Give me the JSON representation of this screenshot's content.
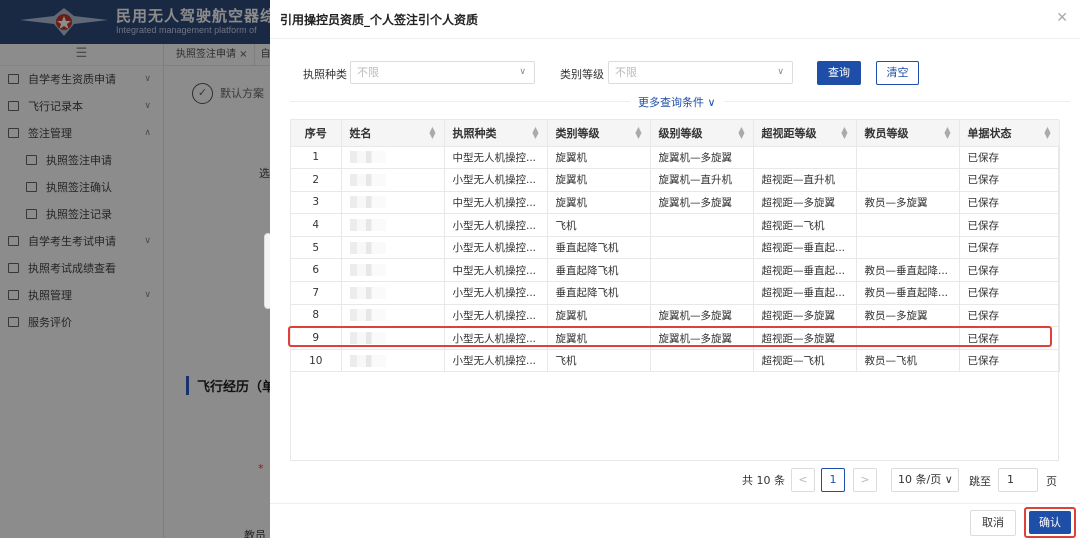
{
  "app": {
    "title": "民用无人驾驶航空器综合",
    "subtitle": "Integrated management platform of",
    "sidebar_toggle": "☰",
    "menu": [
      {
        "label": "自学考生资质申请",
        "chev": "∨",
        "sub": false
      },
      {
        "label": "飞行记录本",
        "chev": "∨",
        "sub": false
      },
      {
        "label": "签注管理",
        "chev": "∧",
        "sub": false
      },
      {
        "label": "执照签注申请",
        "chev": "",
        "sub": true
      },
      {
        "label": "执照签注确认",
        "chev": "",
        "sub": true
      },
      {
        "label": "执照签注记录",
        "chev": "",
        "sub": true
      },
      {
        "label": "自学考生考试申请",
        "chev": "∨",
        "sub": false
      },
      {
        "label": "执照考试成绩查看",
        "chev": "",
        "sub": false
      },
      {
        "label": "执照管理",
        "chev": "∨",
        "sub": false
      },
      {
        "label": "服务评价",
        "chev": "",
        "sub": false
      }
    ],
    "tabs": [
      "执照签注申请 ×",
      "自"
    ],
    "default_scheme": "默认方案",
    "bg_label_select": "选",
    "section_title": "飞行经历（单",
    "bg_star": "*",
    "bg_label_instructor": "教员"
  },
  "dialog": {
    "title": "引用操控员资质_个人签注引个人资质",
    "close": "✕",
    "filters": {
      "license_type_label": "执照种类",
      "license_type_value": "不限",
      "category_label": "类别等级",
      "category_value": "不限"
    },
    "search_label": "查询",
    "clear_label": "清空",
    "more_conditions": "更多查询条件 ∨",
    "columns": [
      "序号",
      "姓名",
      "执照种类",
      "类别等级",
      "级别等级",
      "超视距等级",
      "教员等级",
      "单据状态"
    ],
    "rows": [
      [
        "1",
        "",
        "中型无人机操控...",
        "旋翼机",
        "旋翼机—多旋翼",
        "",
        "",
        "已保存"
      ],
      [
        "2",
        "",
        "小型无人机操控...",
        "旋翼机",
        "旋翼机—直升机",
        "超视距—直升机",
        "",
        "已保存"
      ],
      [
        "3",
        "",
        "中型无人机操控...",
        "旋翼机",
        "旋翼机—多旋翼",
        "超视距—多旋翼",
        "教员—多旋翼",
        "已保存"
      ],
      [
        "4",
        "",
        "小型无人机操控...",
        "飞机",
        "",
        "超视距—飞机",
        "",
        "已保存"
      ],
      [
        "5",
        "",
        "小型无人机操控...",
        "垂直起降飞机",
        "",
        "超视距—垂直起...",
        "",
        "已保存"
      ],
      [
        "6",
        "",
        "中型无人机操控...",
        "垂直起降飞机",
        "",
        "超视距—垂直起...",
        "教员—垂直起降...",
        "已保存"
      ],
      [
        "7",
        "",
        "小型无人机操控...",
        "垂直起降飞机",
        "",
        "超视距—垂直起...",
        "教员—垂直起降...",
        "已保存"
      ],
      [
        "8",
        "",
        "小型无人机操控...",
        "旋翼机",
        "旋翼机—多旋翼",
        "超视距—多旋翼",
        "教员—多旋翼",
        "已保存"
      ],
      [
        "9",
        "",
        "小型无人机操控...",
        "旋翼机",
        "旋翼机—多旋翼",
        "超视距—多旋翼",
        "",
        "已保存"
      ],
      [
        "10",
        "",
        "小型无人机操控...",
        "飞机",
        "",
        "超视距—飞机",
        "教员—飞机",
        "已保存"
      ]
    ],
    "pagination": {
      "total": "共 10 条",
      "prev": "<",
      "current": "1",
      "next": ">",
      "page_size": "10 条/页 ∨",
      "jump_label": "跳至",
      "jump_value": "1",
      "page_suffix": "页"
    },
    "cancel_label": "取消",
    "confirm_label": "确认"
  },
  "colors": {
    "primary": "#1f4ea8",
    "header": "#2f4a7a",
    "highlight": "#e0403a"
  }
}
